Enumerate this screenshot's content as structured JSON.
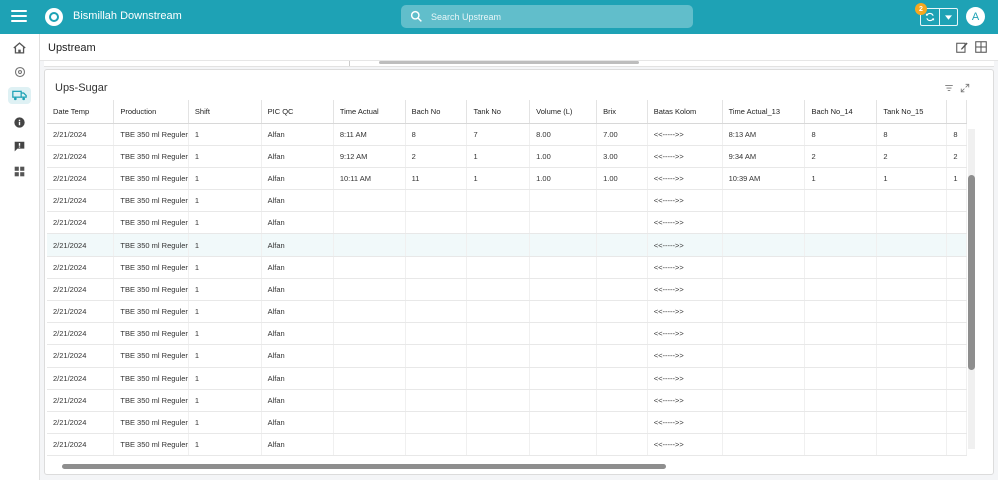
{
  "app": {
    "title": "Bismillah Downstream",
    "search_placeholder": "Search Upstream",
    "notification_count": "2",
    "avatar_initial": "A",
    "accent_color": "#1ea2b5"
  },
  "sidebar": {
    "items": [
      {
        "icon": "home-icon"
      },
      {
        "icon": "settings-icon"
      },
      {
        "icon": "truck-icon",
        "active": true
      },
      {
        "icon": "info-icon"
      },
      {
        "icon": "feedback-icon"
      },
      {
        "icon": "dashboard-icon"
      }
    ]
  },
  "page": {
    "title": "Upstream"
  },
  "panel": {
    "title": "Ups-Sugar"
  },
  "table": {
    "columns": [
      "Date Temp",
      "Production",
      "Shift",
      "PIC QC",
      "Time Actual",
      "Bach No",
      "Tank No",
      "Volume (L)",
      "Brix",
      "Batas Kolom",
      "Time Actual_13",
      "Bach No_14",
      "Tank No_15",
      ""
    ],
    "rows": [
      [
        "2/21/2024",
        "TBE 350 ml Reguler",
        "1",
        "Alfan",
        "8:11 AM",
        "8",
        "7",
        "8.00",
        "7.00",
        "<<----->>",
        "8:13 AM",
        "8",
        "8",
        "8"
      ],
      [
        "2/21/2024",
        "TBE 350 ml Reguler",
        "1",
        "Alfan",
        "9:12 AM",
        "2",
        "1",
        "1.00",
        "3.00",
        "<<----->>",
        "9:34 AM",
        "2",
        "2",
        "2"
      ],
      [
        "2/21/2024",
        "TBE 350 ml Reguler",
        "1",
        "Alfan",
        "10:11 AM",
        "11",
        "1",
        "1.00",
        "1.00",
        "<<----->>",
        "10:39 AM",
        "1",
        "1",
        "1"
      ],
      [
        "2/21/2024",
        "TBE 350 ml Reguler",
        "1",
        "Alfan",
        "",
        "",
        "",
        "",
        "",
        "<<----->>",
        "",
        "",
        "",
        ""
      ],
      [
        "2/21/2024",
        "TBE 350 ml Reguler",
        "1",
        "Alfan",
        "",
        "",
        "",
        "",
        "",
        "<<----->>",
        "",
        "",
        "",
        ""
      ],
      [
        "2/21/2024",
        "TBE 350 ml Reguler",
        "1",
        "Alfan",
        "",
        "",
        "",
        "",
        "",
        "<<----->>",
        "",
        "",
        "",
        ""
      ],
      [
        "2/21/2024",
        "TBE 350 ml Reguler",
        "1",
        "Alfan",
        "",
        "",
        "",
        "",
        "",
        "<<----->>",
        "",
        "",
        "",
        ""
      ],
      [
        "2/21/2024",
        "TBE 350 ml Reguler",
        "1",
        "Alfan",
        "",
        "",
        "",
        "",
        "",
        "<<----->>",
        "",
        "",
        "",
        ""
      ],
      [
        "2/21/2024",
        "TBE 350 ml Reguler",
        "1",
        "Alfan",
        "",
        "",
        "",
        "",
        "",
        "<<----->>",
        "",
        "",
        "",
        ""
      ],
      [
        "2/21/2024",
        "TBE 350 ml Reguler",
        "1",
        "Alfan",
        "",
        "",
        "",
        "",
        "",
        "<<----->>",
        "",
        "",
        "",
        ""
      ],
      [
        "2/21/2024",
        "TBE 350 ml Reguler",
        "1",
        "Alfan",
        "",
        "",
        "",
        "",
        "",
        "<<----->>",
        "",
        "",
        "",
        ""
      ],
      [
        "2/21/2024",
        "TBE 350 ml Reguler",
        "1",
        "Alfan",
        "",
        "",
        "",
        "",
        "",
        "<<----->>",
        "",
        "",
        "",
        ""
      ],
      [
        "2/21/2024",
        "TBE 350 ml Reguler",
        "1",
        "Alfan",
        "",
        "",
        "",
        "",
        "",
        "<<----->>",
        "",
        "",
        "",
        ""
      ],
      [
        "2/21/2024",
        "TBE 350 ml Reguler",
        "1",
        "Alfan",
        "",
        "",
        "",
        "",
        "",
        "<<----->>",
        "",
        "",
        "",
        ""
      ],
      [
        "2/21/2024",
        "TBE 350 ml Reguler",
        "1",
        "Alfan",
        "",
        "",
        "",
        "",
        "",
        "<<----->>",
        "",
        "",
        "",
        ""
      ]
    ],
    "highlighted_row": 5
  }
}
